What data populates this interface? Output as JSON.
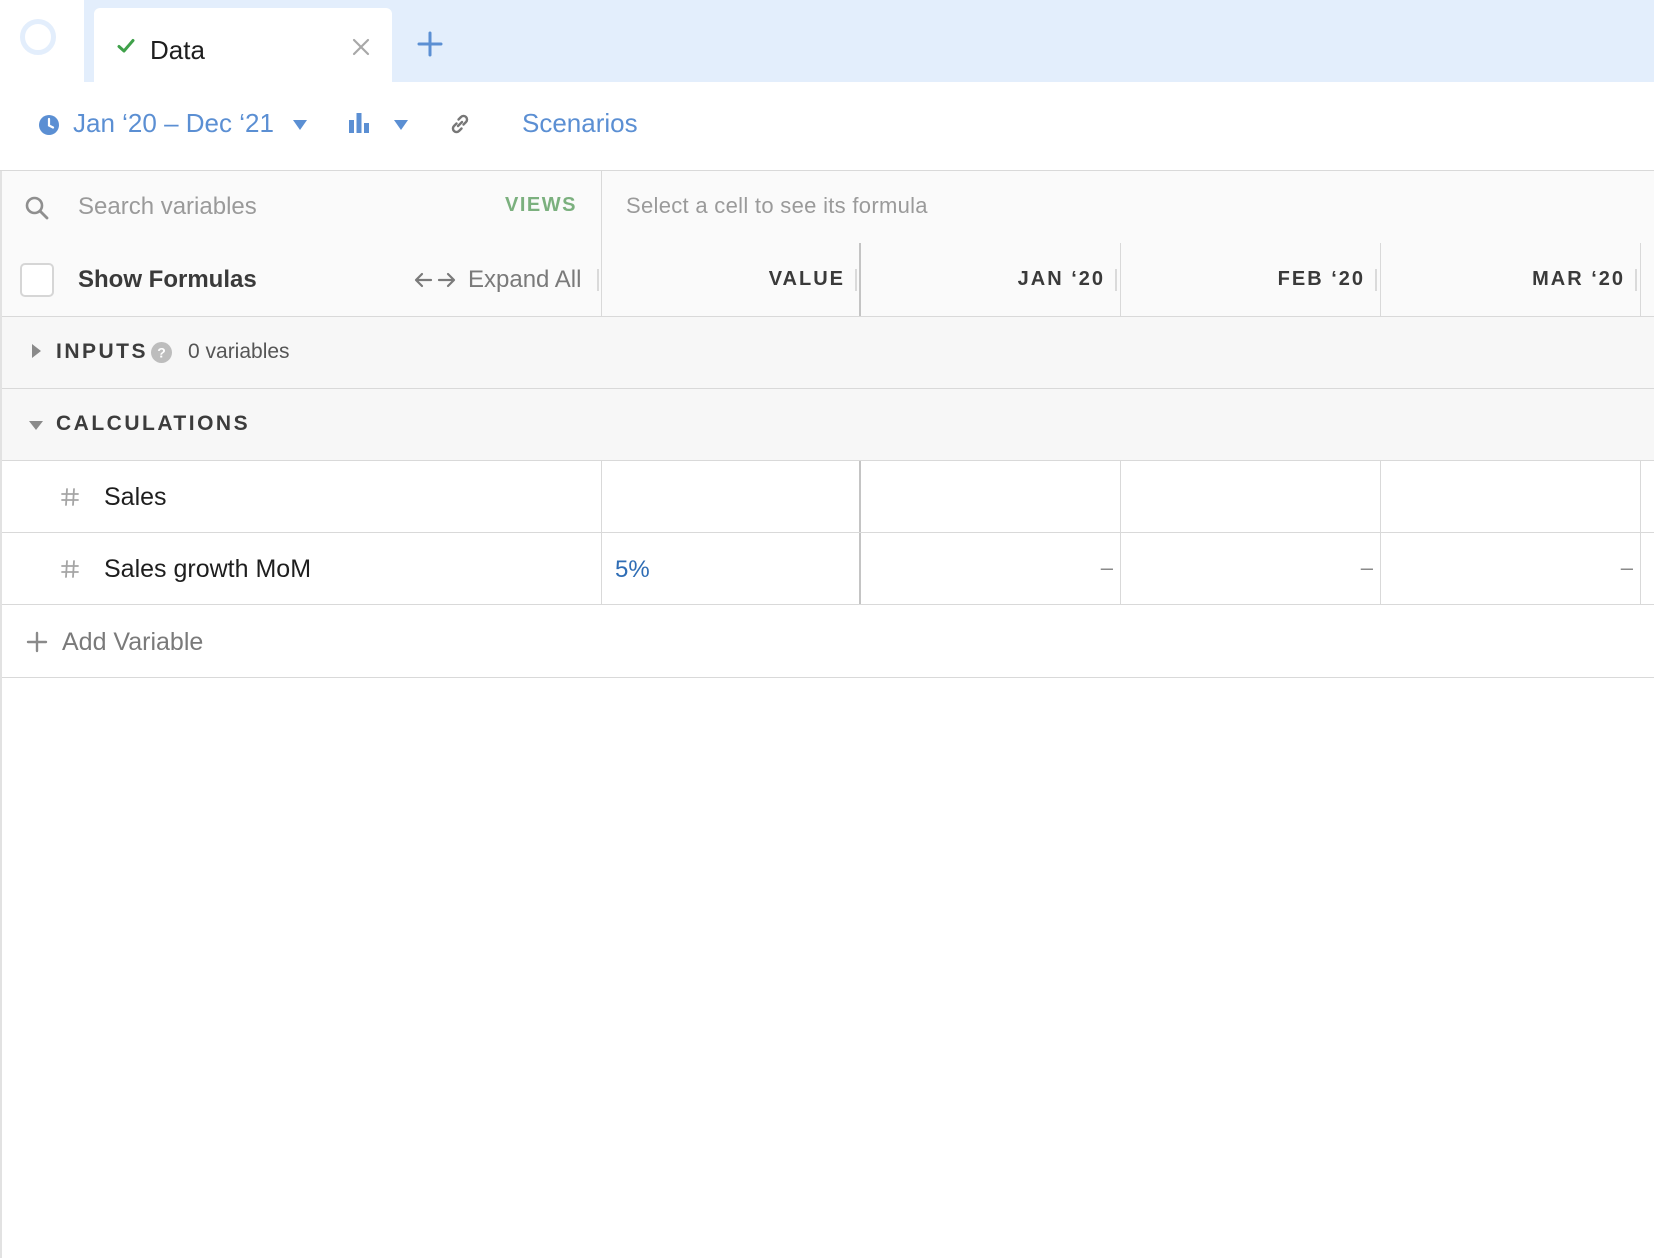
{
  "tabs": [
    {
      "label": "Data",
      "status": "saved"
    }
  ],
  "toolbar": {
    "date_range": "Jan ‘20 – Dec ‘21",
    "scenarios_label": "Scenarios"
  },
  "search": {
    "placeholder": "Search variables",
    "value": "",
    "views_label": "VIEWS"
  },
  "formula_bar": {
    "hint": "Select a cell to see its formula"
  },
  "header": {
    "show_formulas_label": "Show Formulas",
    "show_formulas_checked": false,
    "expand_all_label": "Expand All",
    "columns": [
      "VALUE",
      "JAN ‘20",
      "FEB ‘20",
      "MAR ‘20"
    ]
  },
  "sections": {
    "inputs": {
      "title": "INPUTS",
      "count_label": "0 variables",
      "expanded": false
    },
    "calculations": {
      "title": "CALCULATIONS",
      "expanded": true
    }
  },
  "variables": [
    {
      "name": "Sales",
      "value": "",
      "cells": [
        "",
        "",
        ""
      ]
    },
    {
      "name": "Sales growth MoM",
      "value": "5%",
      "cells": [
        "–",
        "–",
        "–"
      ]
    }
  ],
  "add_variable_label": "Add Variable",
  "colors": {
    "accent_blue": "#5b8fd3",
    "views_green": "#7bb07e",
    "check_green": "#3fa14a",
    "tabbar_bg": "#e3eefc"
  },
  "icons": [
    "app-logo",
    "check-icon",
    "close-icon",
    "plus-icon",
    "clock-icon",
    "bar-chart-icon",
    "link-icon",
    "search-icon",
    "expand-arrows-icon",
    "help-icon",
    "hash-icon"
  ]
}
